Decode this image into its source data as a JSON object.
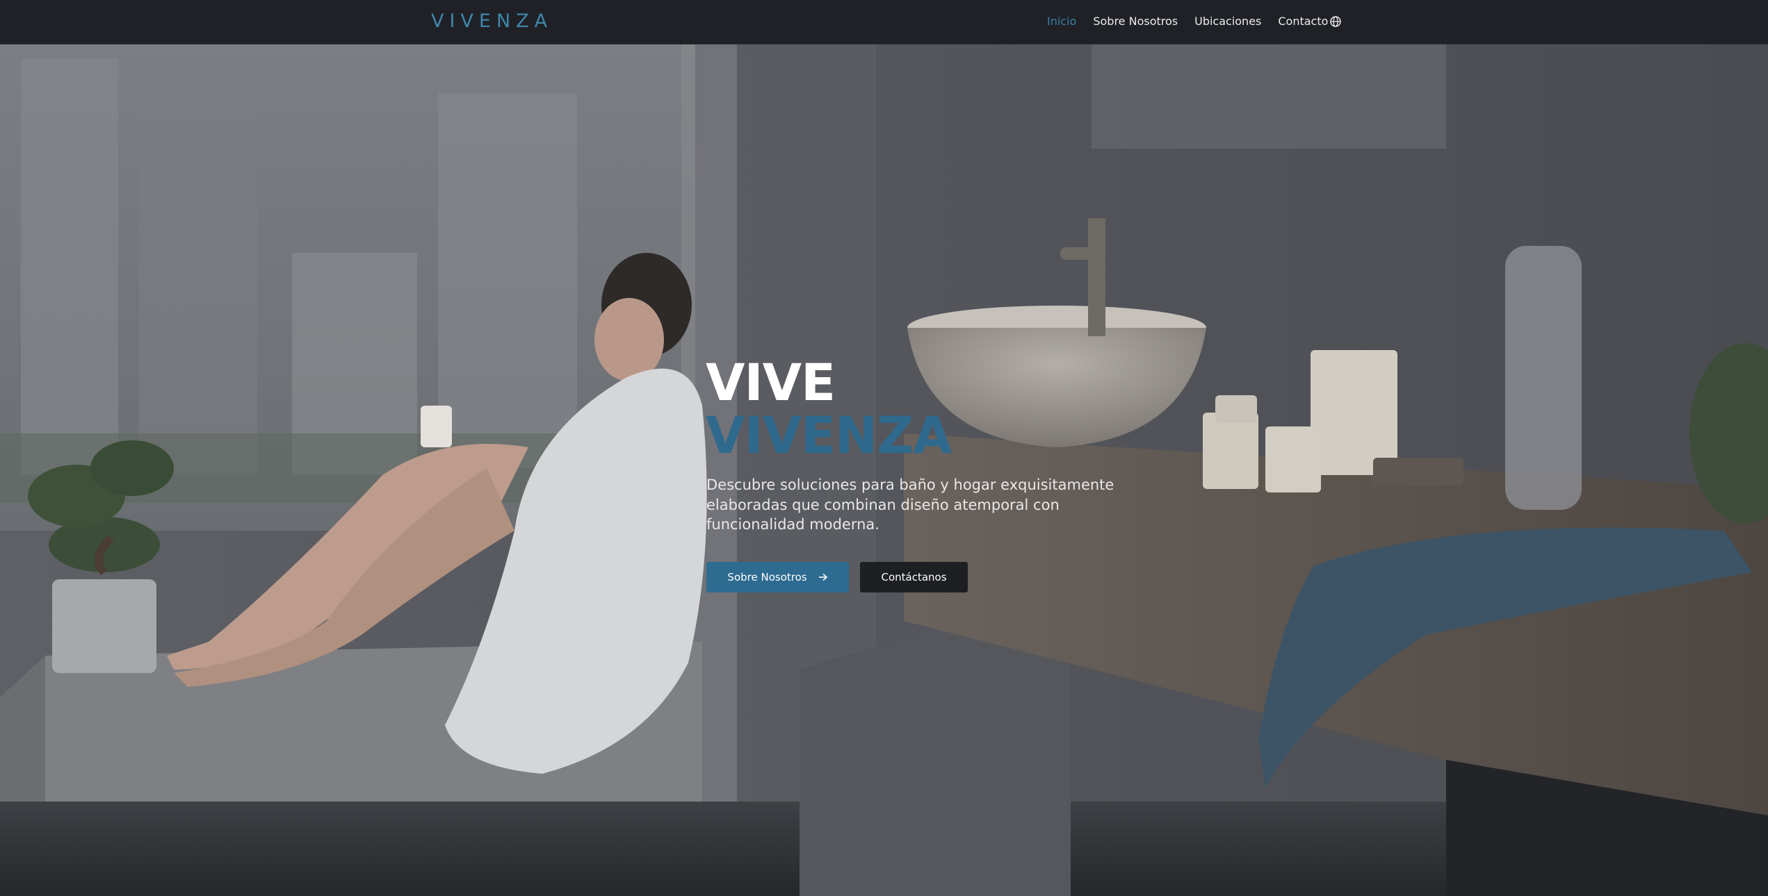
{
  "brand": {
    "logo_text": "VIVENZA",
    "accent_color": "#2f6a8e"
  },
  "nav": {
    "items": [
      {
        "label": "Inicio",
        "active": true
      },
      {
        "label": "Sobre Nosotros",
        "active": false
      },
      {
        "label": "Ubicaciones",
        "active": false
      },
      {
        "label": "Contacto",
        "active": false
      }
    ],
    "language_icon": "globe-icon"
  },
  "hero": {
    "title_line1": "VIVE",
    "title_line2": "VIVENZA",
    "description": "Descubre soluciones para baño y hogar exquisitamente elaboradas que combinan diseño atemporal con funcionalidad moderna.",
    "primary_button": {
      "label": "Sobre Nosotros",
      "icon": "arrow-right-icon"
    },
    "secondary_button": {
      "label": "Contáctanos"
    }
  }
}
